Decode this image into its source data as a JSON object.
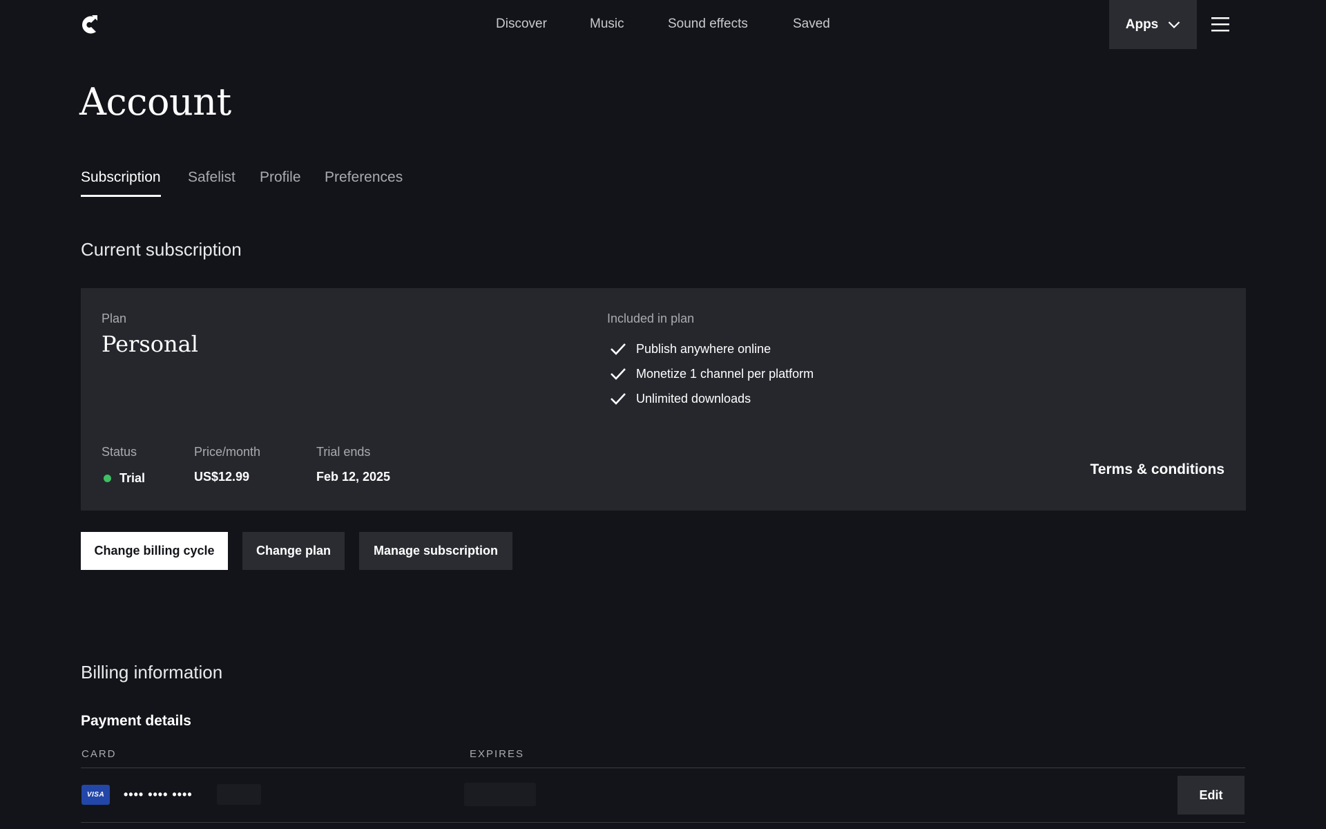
{
  "nav": {
    "links": [
      "Discover",
      "Music",
      "Sound effects",
      "Saved"
    ],
    "apps_label": "Apps"
  },
  "page": {
    "title": "Account",
    "tabs": [
      "Subscription",
      "Safelist",
      "Profile",
      "Preferences"
    ],
    "active_tab": "Subscription"
  },
  "subscription": {
    "section_title": "Current subscription",
    "plan_label": "Plan",
    "plan_name": "Personal",
    "included_label": "Included in plan",
    "features": [
      "Publish anywhere online",
      "Monetize 1 channel per platform",
      "Unlimited downloads"
    ],
    "status_label": "Status",
    "status_value": "Trial",
    "status_color": "#3fbf63",
    "price_label": "Price/month",
    "price_value": "US$12.99",
    "trial_label": "Trial ends",
    "trial_value": "Feb 12, 2025",
    "terms_link": "Terms & conditions"
  },
  "actions": {
    "change_billing": "Change billing cycle",
    "change_plan": "Change plan",
    "manage": "Manage subscription"
  },
  "billing": {
    "section_title": "Billing information",
    "payment_title": "Payment details",
    "col_card": "CARD",
    "col_expires": "EXPIRES",
    "card_brand": "VISA",
    "card_masked": "•••• •••• ••••",
    "edit_label": "Edit"
  },
  "colors": {
    "background": "#131419",
    "card": "#25272d",
    "button_dark": "#2a2c31",
    "visa": "#2347a8"
  }
}
